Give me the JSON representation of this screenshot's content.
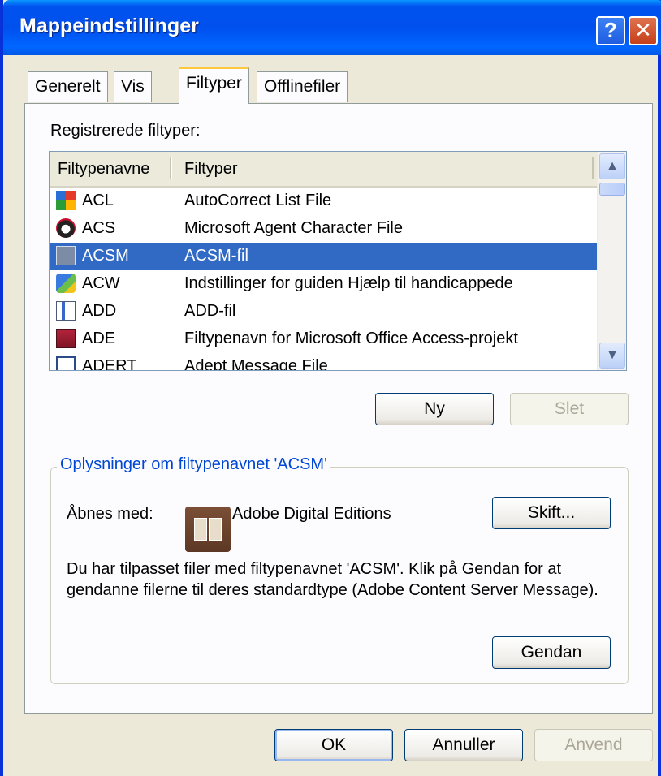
{
  "window": {
    "title": "Mappeindstillinger",
    "help_glyph": "?",
    "close_glyph": "✕"
  },
  "tabs": [
    {
      "label": "Generelt"
    },
    {
      "label": "Vis"
    },
    {
      "label": "Filtyper"
    },
    {
      "label": "Offlinefiler"
    }
  ],
  "registered_label": "Registrerede filtyper:",
  "list": {
    "columns": [
      "Filtypenavne",
      "Filtyper"
    ],
    "rows": [
      {
        "ext": "ACL",
        "type": "AutoCorrect List File",
        "icon": "autocorrect-icon"
      },
      {
        "ext": "ACS",
        "type": "Microsoft Agent Character File",
        "icon": "agent-character-icon"
      },
      {
        "ext": "ACSM",
        "type": "ACSM-fil",
        "icon": "adobe-digital-editions-icon",
        "selected": true
      },
      {
        "ext": "ACW",
        "type": "Indstillinger for guiden Hjælp til handicappede",
        "icon": "accessibility-wizard-icon"
      },
      {
        "ext": "ADD",
        "type": "ADD-fil",
        "icon": "generic-file-icon"
      },
      {
        "ext": "ADE",
        "type": "Filtypenavn for Microsoft Office Access-projekt",
        "icon": "access-project-icon"
      },
      {
        "ext": "ADERT",
        "type": "Adept Message File",
        "icon": "message-file-icon"
      }
    ],
    "scroll_up_glyph": "▲",
    "scroll_down_glyph": "▼"
  },
  "buttons": {
    "new": "Ny",
    "delete": "Slet",
    "change": "Skift...",
    "restore": "Gendan",
    "ok": "OK",
    "cancel": "Annuller",
    "apply": "Anvend"
  },
  "details": {
    "group_title": "Oplysninger om filtypenavnet 'ACSM'",
    "opens_with_label": "Åbnes med:",
    "app_name": "Adobe Digital Editions",
    "description": "Du har tilpasset filer med filtypenavnet 'ACSM'. Klik på Gendan for at gendanne filerne til deres standardtype (Adobe Content Server Message)."
  },
  "colors": {
    "selection": "#316ac5",
    "title_bar": "#0050ee",
    "group_title": "#0046d5",
    "active_tab_accent": "#ffc83c"
  }
}
